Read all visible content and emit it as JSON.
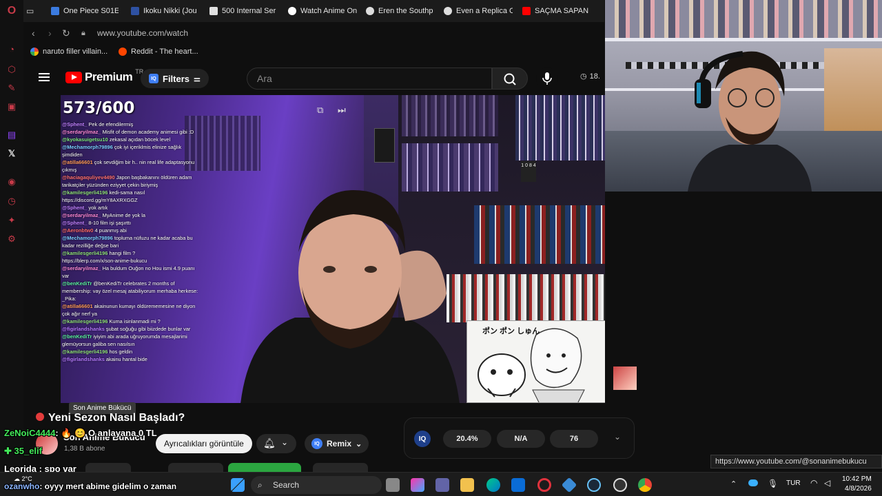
{
  "browser": {
    "tabs": [
      {
        "label": "One Piece S01E",
        "color": "#3b7be0"
      },
      {
        "label": "Ikoku Nikki (Jou",
        "color": "#2e51a2"
      },
      {
        "label": "500 Internal Ser",
        "color": "#e0e0e0"
      },
      {
        "label": "Watch Anime On",
        "color": "#ffffff"
      },
      {
        "label": "Eren the Southp",
        "color": "#dddddd"
      },
      {
        "label": "Even a Replica C",
        "color": "#dddddd"
      },
      {
        "label": "SAÇMA SAPAN",
        "color": "#ff0000"
      }
    ],
    "url": "www.youtube.com/watch",
    "bookmarks": [
      {
        "label": "naruto filler villain...",
        "color": "#4285f4"
      },
      {
        "label": "Reddit - The heart...",
        "color": "#ff4500"
      }
    ]
  },
  "youtube": {
    "logo_word": "Premium",
    "country": "TR",
    "filters_label": "Filters",
    "search_placeholder": "Ara",
    "header_count": "18.",
    "video": {
      "viewer_count": "573/600",
      "chat": [
        {
          "user": "@Sphent_",
          "msg": "Pek de efendilermiş",
          "color": "#c080ff"
        },
        {
          "user": "@serdaryilmaz_",
          "msg": "Misfit of demon academy animesi gibi :D",
          "color": "#ff8ad8"
        },
        {
          "user": "@kyokasuigetsu10",
          "msg": "zekasal açıdan böcek level",
          "color": "#7ee87e"
        },
        {
          "user": "@Mechamorph79896",
          "msg": "çok iyi içeriklmis elinize sağlık şimdiden",
          "color": "#7ad0ff"
        },
        {
          "user": "@atilla66601",
          "msg": "çok sevdiğim bir h.. nin real life adaptasyonu çıkmış",
          "color": "#ff9b5a"
        },
        {
          "user": "@haciagaquliyev4490",
          "msg": "Japon başbakanını öldüren adam tarikatçiler yüzünden eziyyet çekin biriymiş",
          "color": "#ff7070"
        },
        {
          "user": "@kamilesgerli4196",
          "msg": "kedi-sama nasıl",
          "color": "#8fe07a"
        },
        {
          "user": "",
          "msg": "https://discord.gg/mY8AXRXGGZ",
          "color": "#ffffff"
        },
        {
          "user": "@Sphent_",
          "msg": "yok artık",
          "color": "#c080ff"
        },
        {
          "user": "@serdaryilmaz_",
          "msg": "MyAnime de yok la",
          "color": "#ff8ad8"
        },
        {
          "user": "@Sphent_",
          "msg": "8-10 film işi şaşırttı",
          "color": "#c080ff"
        },
        {
          "user": "@Aeronbtw0",
          "msg": "4 puanmış abi",
          "color": "#ff6b6b"
        },
        {
          "user": "@Mechamorph79896",
          "msg": "topluma nüfuzu ne kadar acaba bu kadar rezilliğe değse bari",
          "color": "#7ad0ff"
        },
        {
          "user": "@kamilesgerli4196",
          "msg": "hangi film ?",
          "color": "#8fe07a"
        },
        {
          "user": "",
          "msg": "https://blerp.com/x/son-anime-bukucu",
          "color": "#ffffff"
        },
        {
          "user": "@serdaryilmaz_",
          "msg": "Ha buldum Ouğon no Hou ismi 4.9 puanı var",
          "color": "#ff8ad8"
        },
        {
          "user": "@benKediTr",
          "msg": "@benKediTr celebrates 2 months of membership: vay özel mesaj atabiliyorum merhaba herkese: _Pika:",
          "color": "#5af0a0"
        },
        {
          "user": "@atilla66601",
          "msg": "akainunun kumayı öldürememesine ne diyon çok ağır nerf ya",
          "color": "#ff9b5a"
        },
        {
          "user": "@kamilesgerli4196",
          "msg": "Kuma isinlanmadi mi ?",
          "color": "#8fe07a"
        },
        {
          "user": "@figirlandshanks",
          "msg": "şubat soğuğu gibi biizdede bunlar var",
          "color": "#b57aff"
        },
        {
          "user": "@benKediTr",
          "msg": "iyiyim abi arada uğruyorumda mesajlarimi glemüyorsun galiba sen nasılsın",
          "color": "#5af0a0"
        },
        {
          "user": "@kamilesgerli4196",
          "msg": "hos geldin",
          "color": "#8fe07a"
        },
        {
          "user": "@figirlandshanks",
          "msg": "akainu hantal bide",
          "color": "#b57aff"
        }
      ],
      "manga_text": "ポン ポン しゅん",
      "shelf_sign": "1 0 8 4"
    },
    "title": "Yeni Sezon Nasıl Başladı?",
    "tooltip": "Son Anime Bükücü",
    "channel_name": "Son Anime Bükücü",
    "subscribers": "1,38 B abone",
    "join_label": "Ayrıcalıkları görüntüle",
    "remix_label": "Remix",
    "stats": [
      "20.4%",
      "N/A",
      "76"
    ],
    "hover_url": "https://www.youtube.com/@sonanimebukucu"
  },
  "stream_overlay": {
    "line1_user": "ZeNoiC4444",
    "line1_msg": ": 🔥 😊 O anlayana 0 TL",
    "line2": "35_elif",
    "line3_user": "Leorida",
    "line3_msg": ": spo var",
    "line4_user": "ozanwho",
    "line4_msg": ": oyyy mert abime gidelim o zaman"
  },
  "taskbar": {
    "weather": "2°C",
    "search_label": "Search",
    "lang": "TUR",
    "time": "10:42 PM",
    "date": "4/8/2026"
  },
  "colors": {
    "accent": "#ff0000",
    "opera": "#c63a48",
    "iq_blue": "#3f7ff6"
  }
}
